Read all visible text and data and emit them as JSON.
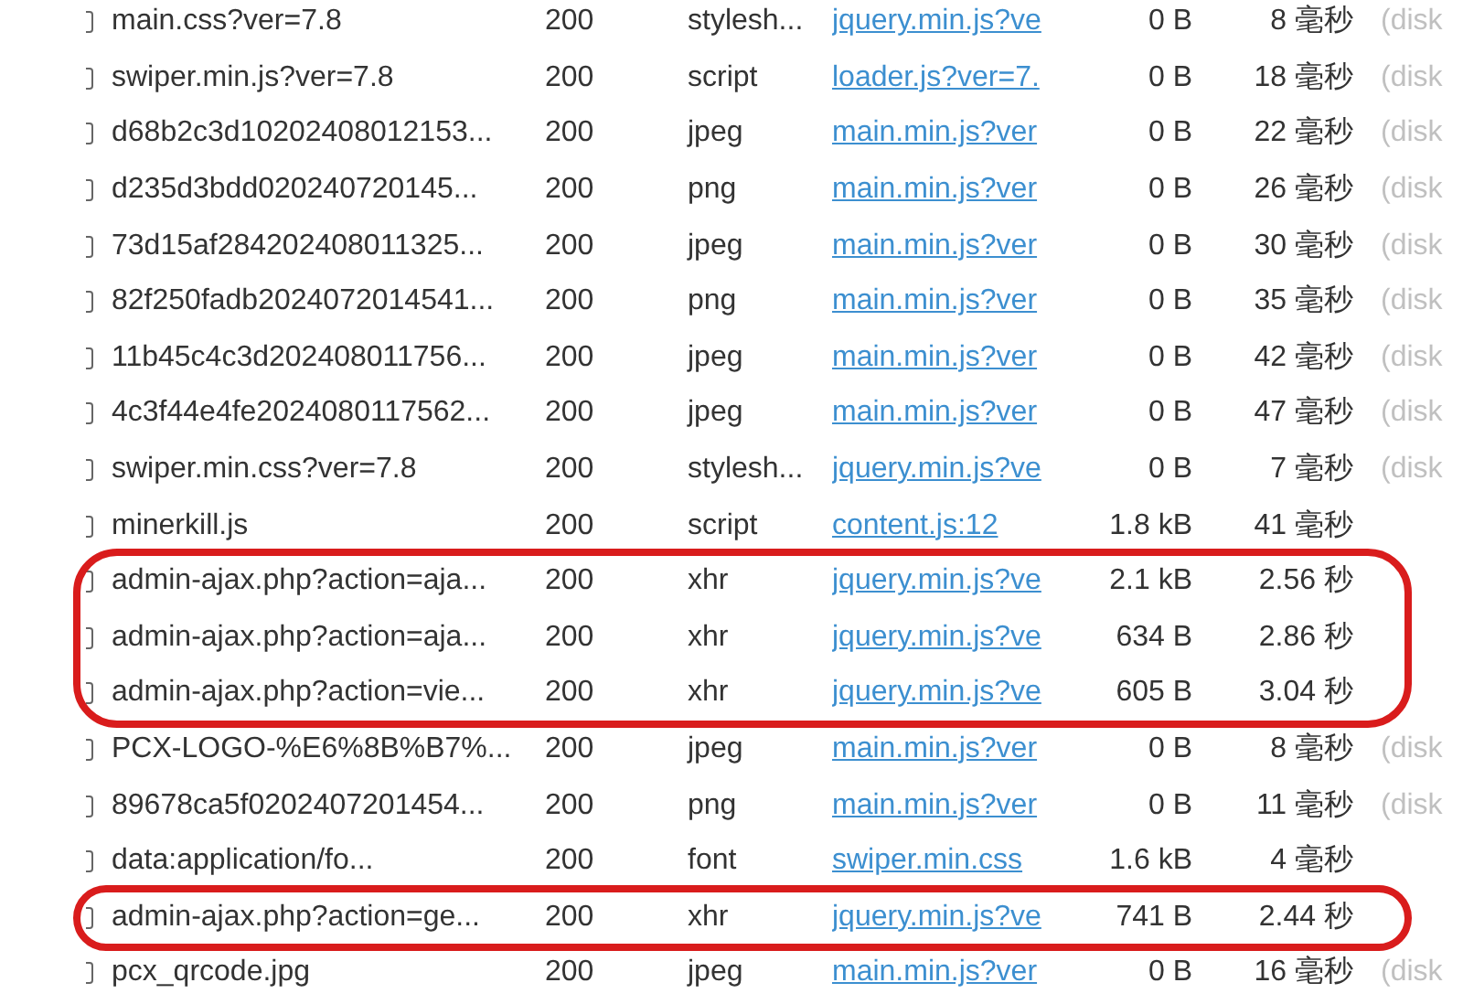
{
  "requests": [
    {
      "name": "main.css?ver=7.8",
      "status": "200",
      "type": "stylesh...",
      "initiator": "jquery.min.js?ve",
      "size": "0 B",
      "time": "8 毫秒",
      "source": "(disk",
      "circled": false
    },
    {
      "name": "swiper.min.js?ver=7.8",
      "status": "200",
      "type": "script",
      "initiator": "loader.js?ver=7.",
      "size": "0 B",
      "time": "18 毫秒",
      "source": "(disk",
      "circled": false
    },
    {
      "name": "d68b2c3d10202408012153...",
      "status": "200",
      "type": "jpeg",
      "initiator": "main.min.js?ver",
      "size": "0 B",
      "time": "22 毫秒",
      "source": "(disk",
      "circled": false
    },
    {
      "name": "d235d3bdd020240720145...",
      "status": "200",
      "type": "png",
      "initiator": "main.min.js?ver",
      "size": "0 B",
      "time": "26 毫秒",
      "source": "(disk",
      "circled": false
    },
    {
      "name": "73d15af284202408011325...",
      "status": "200",
      "type": "jpeg",
      "initiator": "main.min.js?ver",
      "size": "0 B",
      "time": "30 毫秒",
      "source": "(disk",
      "circled": false
    },
    {
      "name": "82f250fadb2024072014541...",
      "status": "200",
      "type": "png",
      "initiator": "main.min.js?ver",
      "size": "0 B",
      "time": "35 毫秒",
      "source": "(disk",
      "circled": false
    },
    {
      "name": "11b45c4c3d202408011756...",
      "status": "200",
      "type": "jpeg",
      "initiator": "main.min.js?ver",
      "size": "0 B",
      "time": "42 毫秒",
      "source": "(disk",
      "circled": false
    },
    {
      "name": "4c3f44e4fe2024080117562...",
      "status": "200",
      "type": "jpeg",
      "initiator": "main.min.js?ver",
      "size": "0 B",
      "time": "47 毫秒",
      "source": "(disk",
      "circled": false
    },
    {
      "name": "swiper.min.css?ver=7.8",
      "status": "200",
      "type": "stylesh...",
      "initiator": "jquery.min.js?ve",
      "size": "0 B",
      "time": "7 毫秒",
      "source": "(disk",
      "circled": false
    },
    {
      "name": "minerkill.js",
      "status": "200",
      "type": "script",
      "initiator": "content.js:12",
      "size": "1.8 kB",
      "time": "41 毫秒",
      "circled": false
    },
    {
      "name": "admin-ajax.php?action=aja...",
      "status": "200",
      "type": "xhr",
      "initiator": "jquery.min.js?ve",
      "size": "2.1 kB",
      "time": "2.56 秒",
      "circled": true
    },
    {
      "name": "admin-ajax.php?action=aja...",
      "status": "200",
      "type": "xhr",
      "initiator": "jquery.min.js?ve",
      "size": "634 B",
      "time": "2.86 秒",
      "circled": true
    },
    {
      "name": "admin-ajax.php?action=vie...",
      "status": "200",
      "type": "xhr",
      "initiator": "jquery.min.js?ve",
      "size": "605 B",
      "time": "3.04 秒",
      "circled": true
    },
    {
      "name": "PCX-LOGO-%E6%8B%B7%...",
      "status": "200",
      "type": "jpeg",
      "initiator": "main.min.js?ver",
      "size": "0 B",
      "time": "8 毫秒",
      "source": "(disk",
      "circled": false
    },
    {
      "name": "89678ca5f0202407201454...",
      "status": "200",
      "type": "png",
      "initiator": "main.min.js?ver",
      "size": "0 B",
      "time": "11 毫秒",
      "source": "(disk",
      "circled": false
    },
    {
      "name": "data:application/fo...",
      "status": "200",
      "type": "font",
      "initiator": "swiper.min.css",
      "size": "1.6 kB",
      "time": "4 毫秒",
      "circled": false
    },
    {
      "name": "admin-ajax.php?action=ge...",
      "status": "200",
      "type": "xhr",
      "initiator": "jquery.min.js?ve",
      "size": "741 B",
      "time": "2.44 秒",
      "circled": true
    },
    {
      "name": "pcx_qrcode.jpg",
      "status": "200",
      "type": "jpeg",
      "initiator": "main.min.js?ver",
      "size": "0 B",
      "time": "16 毫秒",
      "source": "(disk",
      "circled": false
    }
  ]
}
